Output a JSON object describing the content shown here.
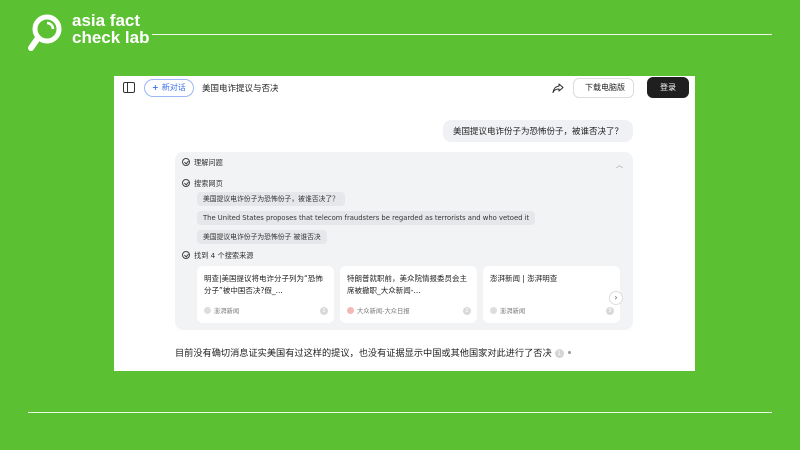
{
  "branding": {
    "line1": "asia fact",
    "line2": "check lab"
  },
  "header": {
    "new_chat_label": "新对话",
    "conversation_title": "美国电诈提议与否决",
    "download_label": "下载电脑版",
    "login_label": "登录"
  },
  "user_message": "美国提议电诈份子为恐怖份子，被谁否决了？",
  "reasoning": {
    "understand_label": "理解问题",
    "search_label": "搜索网页",
    "queries": [
      "美国提议电诈份子为恐怖份子，被谁否决了？",
      "The United States proposes that telecom fraudsters be regarded as terrorists and who vetoed it",
      "美国提议电诈份子为恐怖份子 被谁否决"
    ],
    "found_label": "找到 4 个搜索来源",
    "results": [
      {
        "title": "明查|美国提议将电诈分子列为“恐怖分子”被中国否决?假_...",
        "source": "澎湃新闻",
        "index": "1"
      },
      {
        "title": "特朗普就职前，美众院情报委员会主席被撤职_大众新闻-...",
        "source": "大众新闻-大众日报",
        "index": "2"
      },
      {
        "title": "澎湃新闻 | 澎湃明查",
        "source": "澎湃新闻",
        "index": "3"
      }
    ]
  },
  "answer": {
    "text": "目前没有确切消息证实美国有过这样的提议，也没有证据显示中国或其他国家对此进行了否决",
    "citation": "1"
  },
  "colors": {
    "background": "#5cc132",
    "accent": "#3b6ff0",
    "login_button": "#1f1f1f"
  }
}
